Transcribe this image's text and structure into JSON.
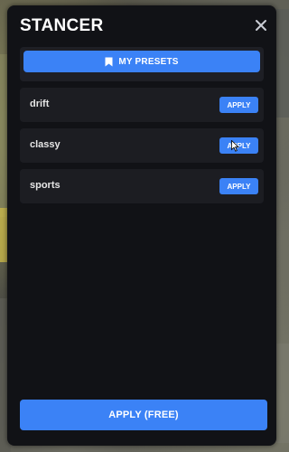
{
  "app": {
    "title": "STANCER"
  },
  "header": {
    "close_icon": "close-icon"
  },
  "presets_button": {
    "label": "MY PRESETS",
    "icon": "bookmark-icon"
  },
  "presets": [
    {
      "name": "drift",
      "apply_label": "APPLY"
    },
    {
      "name": "classy",
      "apply_label": "APPLY"
    },
    {
      "name": "sports",
      "apply_label": "APPLY"
    }
  ],
  "footer": {
    "apply_label": "APPLY (FREE)"
  },
  "colors": {
    "accent": "#3b82f6",
    "panel": "#111216",
    "row": "#1c1d22"
  }
}
